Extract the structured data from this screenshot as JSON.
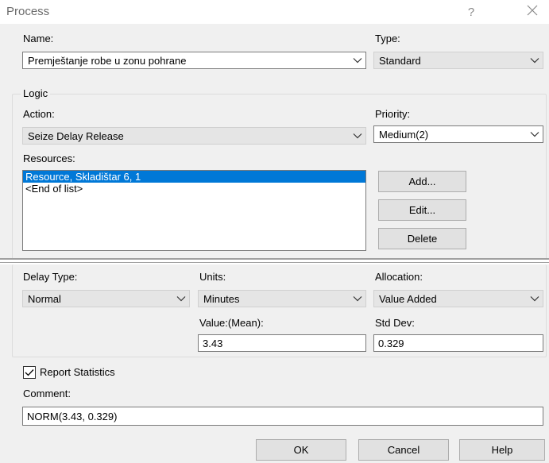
{
  "window": {
    "title": "Process",
    "help_glyph": "?",
    "close_glyph": "✕"
  },
  "main": {
    "name_label": "Name:",
    "name_value": "Premještanje robe u zonu pohrane",
    "type_label": "Type:",
    "type_value": "Standard"
  },
  "logic": {
    "group_title": "Logic",
    "action_label": "Action:",
    "action_value": "Seize Delay Release",
    "priority_label": "Priority:",
    "priority_value": "Medium(2)",
    "resources_label": "Resources:",
    "resources": [
      {
        "text": "Resource, Skladištar 6, 1",
        "selected": true
      },
      {
        "text": "<End of list>",
        "selected": false
      }
    ],
    "add_label": "Add...",
    "edit_label": "Edit...",
    "delete_label": "Delete"
  },
  "delay": {
    "delay_type_label": "Delay Type:",
    "delay_type_value": "Normal",
    "units_label": "Units:",
    "units_value": "Minutes",
    "allocation_label": "Allocation:",
    "allocation_value": "Value Added",
    "value_label": "Value:(Mean):",
    "value_value": "3.43",
    "stddev_label": "Std Dev:",
    "stddev_value": "0.329"
  },
  "footer": {
    "report_statistics_label": "Report Statistics",
    "report_statistics_checked": true,
    "comment_label": "Comment:",
    "comment_value": "NORM(3.43, 0.329)",
    "ok_label": "OK",
    "cancel_label": "Cancel",
    "help_label": "Help"
  },
  "colors": {
    "selection": "#0078d7",
    "panel_background": "#f0f0f0",
    "button_face": "#e1e1e1"
  }
}
